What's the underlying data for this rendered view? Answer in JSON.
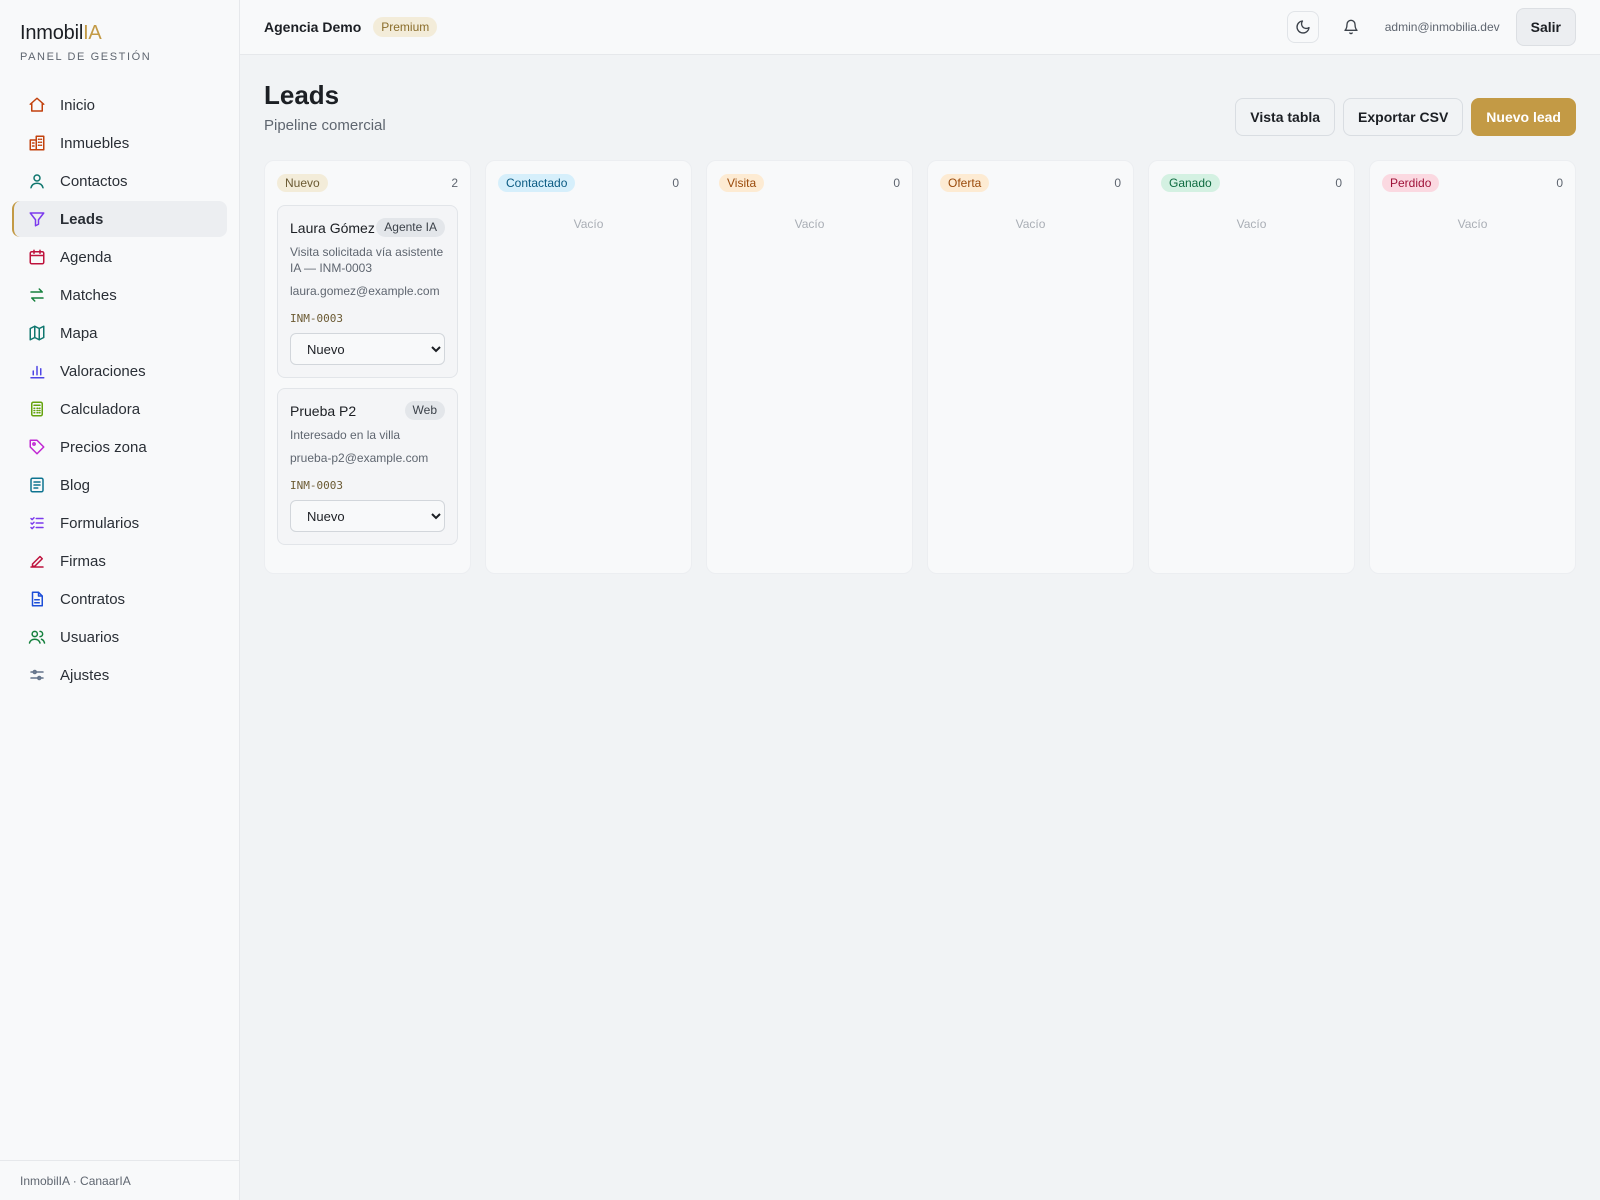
{
  "brand": {
    "name_main": "Inmobil",
    "name_accent": "IA",
    "subtitle": "PANEL DE GESTIÓN",
    "footer": "InmobilIA · CanaarIA"
  },
  "sidebar": {
    "items": [
      {
        "label": "Inicio",
        "icon": "home-icon",
        "color": "#c2410c"
      },
      {
        "label": "Inmuebles",
        "icon": "building-icon",
        "color": "#c2410c"
      },
      {
        "label": "Contactos",
        "icon": "user-icon",
        "color": "#0f766e"
      },
      {
        "label": "Leads",
        "icon": "funnel-icon",
        "color": "#7c3aed",
        "active": true
      },
      {
        "label": "Agenda",
        "icon": "calendar-icon",
        "color": "#be123c"
      },
      {
        "label": "Matches",
        "icon": "arrows-icon",
        "color": "#15803d"
      },
      {
        "label": "Mapa",
        "icon": "map-icon",
        "color": "#0f766e"
      },
      {
        "label": "Valoraciones",
        "icon": "bar-chart-icon",
        "color": "#4f46e5"
      },
      {
        "label": "Calculadora",
        "icon": "calculator-icon",
        "color": "#65a30d"
      },
      {
        "label": "Precios zona",
        "icon": "tag-icon",
        "color": "#c026d3"
      },
      {
        "label": "Blog",
        "icon": "article-icon",
        "color": "#0e7490"
      },
      {
        "label": "Formularios",
        "icon": "checklist-icon",
        "color": "#7c3aed"
      },
      {
        "label": "Firmas",
        "icon": "pen-icon",
        "color": "#be123c"
      },
      {
        "label": "Contratos",
        "icon": "document-icon",
        "color": "#1d4ed8"
      },
      {
        "label": "Usuarios",
        "icon": "users-icon",
        "color": "#15803d"
      },
      {
        "label": "Ajustes",
        "icon": "sliders-icon",
        "color": "#64748b"
      }
    ]
  },
  "topbar": {
    "agency": "Agencia Demo",
    "plan": "Premium",
    "user_email": "admin@inmobilia.dev",
    "logout_label": "Salir"
  },
  "page": {
    "title": "Leads",
    "subtitle": "Pipeline comercial",
    "actions": {
      "table_view": "Vista tabla",
      "export": "Exportar CSV",
      "new_lead": "Nuevo lead"
    }
  },
  "board": {
    "empty_label": "Vacío",
    "columns": [
      {
        "stage": "Nuevo",
        "count": "2",
        "bg": "#f3ecd9",
        "fg": "#6b5a33",
        "cards": [
          {
            "name": "Laura Gómez",
            "source": "Agente IA",
            "note": "Visita solicitada vía asistente IA — INM-0003",
            "email": "laura.gomez@example.com",
            "ref": "INM-0003",
            "stage": "Nuevo"
          },
          {
            "name": "Prueba P2",
            "source": "Web",
            "note": "Interesado en la villa",
            "email": "prueba-p2@example.com",
            "ref": "INM-0003",
            "stage": "Nuevo"
          }
        ]
      },
      {
        "stage": "Contactado",
        "count": "0",
        "bg": "#d6effb",
        "fg": "#0b5b83",
        "cards": []
      },
      {
        "stage": "Visita",
        "count": "0",
        "bg": "#fdebd3",
        "fg": "#9a4a0b",
        "cards": []
      },
      {
        "stage": "Oferta",
        "count": "0",
        "bg": "#fdebd3",
        "fg": "#9a4a0b",
        "cards": []
      },
      {
        "stage": "Ganado",
        "count": "0",
        "bg": "#d4f1e2",
        "fg": "#0e6b40",
        "cards": []
      },
      {
        "stage": "Perdido",
        "count": "0",
        "bg": "#fbd9e1",
        "fg": "#9f1239",
        "cards": []
      }
    ],
    "stage_options": [
      "Nuevo",
      "Contactado",
      "Visita",
      "Oferta",
      "Ganado",
      "Perdido"
    ]
  },
  "colors": {
    "accent": "#c39a45"
  }
}
